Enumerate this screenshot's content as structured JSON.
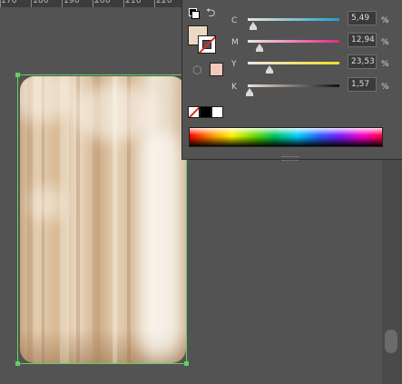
{
  "ruler": {
    "labels": [
      "170",
      "180",
      "190",
      "200",
      "210",
      "220"
    ]
  },
  "color_panel": {
    "fill_color": "#edd8c4",
    "out_of_gamut_color": "#f5c8bf",
    "icons": {
      "default_colors": "default-fill-stroke-icon",
      "swap": "swap-fill-stroke-icon",
      "gamut_warning": "out-of-web-gamut-cube-icon"
    },
    "sliders": [
      {
        "label": "C",
        "value": "5,49",
        "unit": "%",
        "fraction": 0.0549,
        "gradient": [
          "#efe2d8",
          "#1aa1c8"
        ]
      },
      {
        "label": "M",
        "value": "12,94",
        "unit": "%",
        "fraction": 0.1294,
        "gradient": [
          "#f1e6e6",
          "#e0288a"
        ]
      },
      {
        "label": "Y",
        "value": "23,53",
        "unit": "%",
        "fraction": 0.2353,
        "gradient": [
          "#f4e3e3",
          "#f2de21"
        ]
      },
      {
        "label": "K",
        "value": "1,57",
        "unit": "%",
        "fraction": 0.0157,
        "gradient": [
          "#f3e1d5",
          "#111111"
        ]
      }
    ],
    "quick_swatches": [
      "none",
      "black",
      "white"
    ]
  },
  "artboard": {
    "selection_color": "#5fd35f"
  }
}
